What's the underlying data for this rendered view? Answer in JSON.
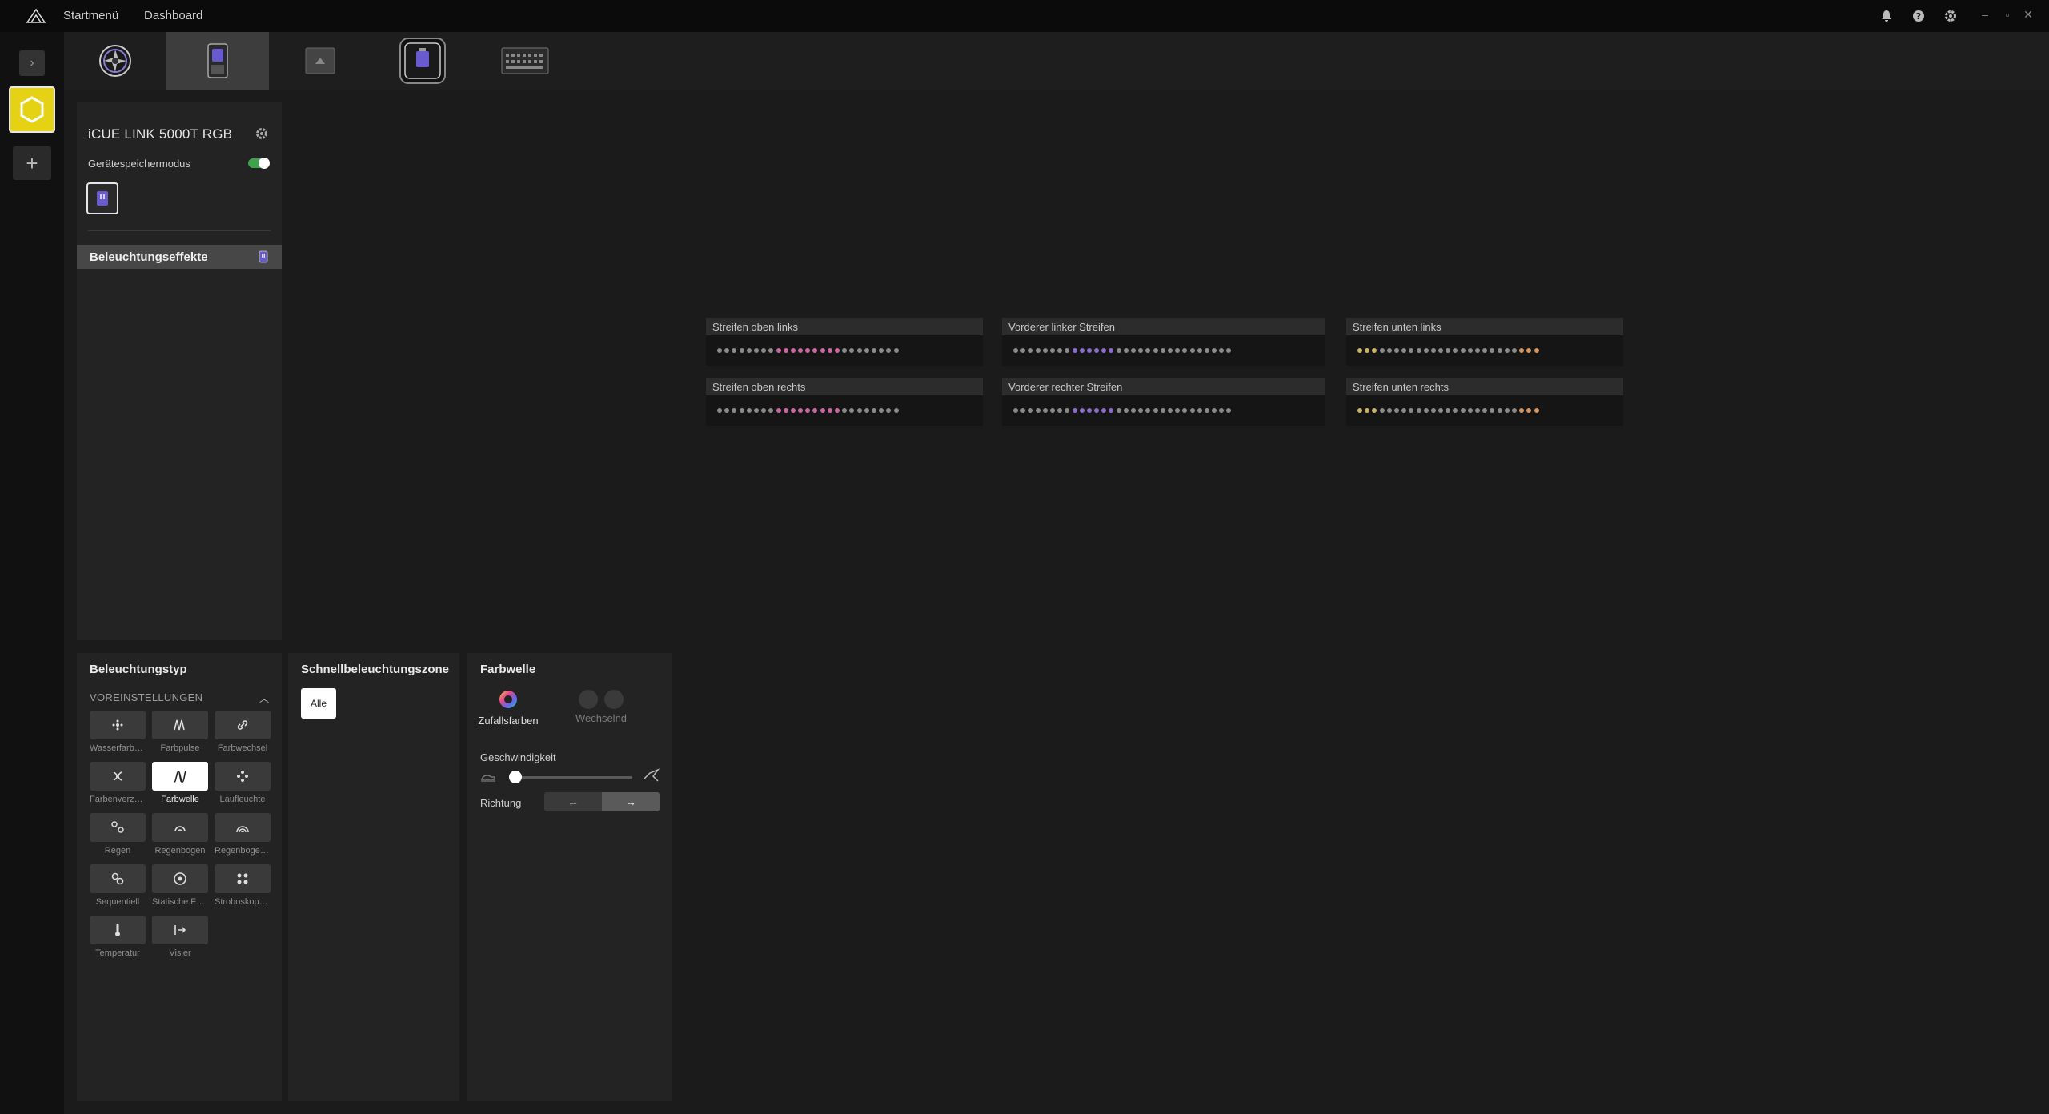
{
  "topbar": {
    "nav": [
      "Startmenü",
      "Dashboard"
    ],
    "icons": [
      "bell-icon",
      "help-icon",
      "gear-icon"
    ],
    "window_controls": [
      "minimize-icon",
      "restore-icon",
      "close-icon"
    ]
  },
  "rail": {
    "expand_icon": "chevron-right-icon",
    "device_icon": "hexagon-icon",
    "add_label": "+"
  },
  "device_tabs": [
    {
      "icon": "fan-icon",
      "active": false
    },
    {
      "icon": "pump-icon",
      "active": true
    },
    {
      "icon": "case-icon",
      "active": false
    },
    {
      "icon": "lcd-icon",
      "active": false
    },
    {
      "icon": "hub-icon",
      "active": false
    }
  ],
  "device_panel": {
    "title": "iCUE LINK 5000T RGB",
    "memory_mode_label": "Gerätespeichermodus",
    "memory_mode_on": true,
    "effects_label": "Beleuchtungseffekte"
  },
  "zones": [
    {
      "label": "Streifen oben links",
      "accent": "#c86aa0",
      "accent_from": 8,
      "accent_to": 16
    },
    {
      "label": "Vorderer linker Streifen",
      "accent": "#8a6ec8",
      "accent_from": 8,
      "accent_to": 13
    },
    {
      "label": "Streifen unten links",
      "accent": "#c8b46a",
      "accent_from": 0,
      "accent_to": 2,
      "accent2": "#d49660",
      "accent2_from": 22,
      "accent2_to": 25
    },
    {
      "label": "Streifen oben rechts",
      "accent": "#c86aa0",
      "accent_from": 8,
      "accent_to": 16
    },
    {
      "label": "Vorderer rechter Streifen",
      "accent": "#8a6ec8",
      "accent_from": 8,
      "accent_to": 13
    },
    {
      "label": "Streifen unten rechts",
      "accent": "#c8b46a",
      "accent_from": 0,
      "accent_to": 2,
      "accent2": "#d49660",
      "accent2_from": 22,
      "accent2_to": 25
    }
  ],
  "lighting_type": {
    "title": "Beleuchtungstyp",
    "presets_header": "VOREINSTELLUNGEN",
    "presets": [
      {
        "label": "Wasserfarbe...",
        "icon": "watercolor-icon",
        "selected": false
      },
      {
        "label": "Farbpulse",
        "icon": "pulse-icon",
        "selected": false
      },
      {
        "label": "Farbwechsel",
        "icon": "link-icon",
        "selected": false
      },
      {
        "label": "Farbenverzer...",
        "icon": "warp-icon",
        "selected": false
      },
      {
        "label": "Farbwelle",
        "icon": "wave-icon",
        "selected": true
      },
      {
        "label": "Laufleuchte",
        "icon": "marquee-icon",
        "selected": false
      },
      {
        "label": "Regen",
        "icon": "rain-icon",
        "selected": false
      },
      {
        "label": "Regenbogen",
        "icon": "rainbow-icon",
        "selected": false
      },
      {
        "label": "Regenbogen...",
        "icon": "rainbow-spiral-icon",
        "selected": false
      },
      {
        "label": "Sequentiell",
        "icon": "sequential-icon",
        "selected": false
      },
      {
        "label": "Statische Far...",
        "icon": "static-color-icon",
        "selected": false
      },
      {
        "label": "Stroboskope...",
        "icon": "strobe-icon",
        "selected": false
      },
      {
        "label": "Temperatur",
        "icon": "thermometer-icon",
        "selected": false
      },
      {
        "label": "Visier",
        "icon": "visor-icon",
        "selected": false
      }
    ]
  },
  "quick_zone": {
    "title": "Schnellbeleuchtungszone",
    "all_label": "Alle"
  },
  "effect": {
    "title": "Farbwelle",
    "random_label": "Zufallsfarben",
    "alternating_label": "Wechselnd",
    "speed_label": "Geschwindigkeit",
    "speed_value": 0.05,
    "direction_label": "Richtung",
    "direction_left": "←",
    "direction_right": "→",
    "direction_selected": "right"
  }
}
